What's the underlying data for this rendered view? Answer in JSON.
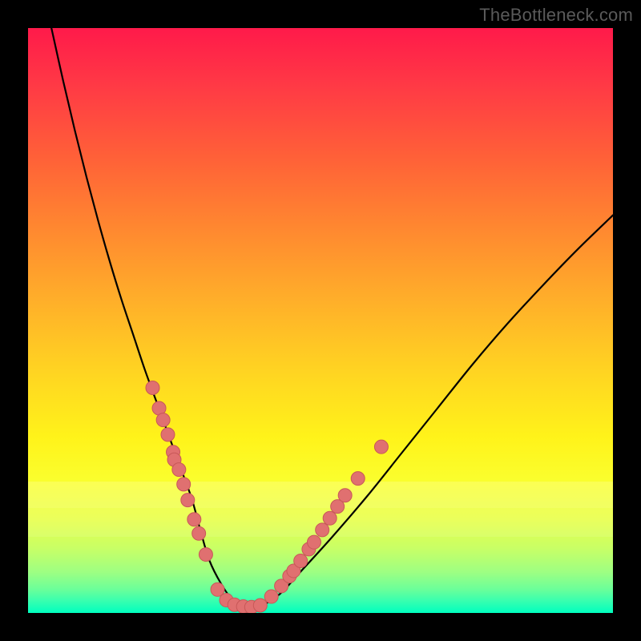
{
  "watermark": "TheBottleneck.com",
  "colors": {
    "frame": "#000000",
    "curve_stroke": "#000000",
    "ring_fill": "#e07070",
    "ring_stroke": "#c85858"
  },
  "chart_data": {
    "type": "line",
    "title": "",
    "xlabel": "",
    "ylabel": "",
    "xlim": [
      0,
      100
    ],
    "ylim": [
      0,
      100
    ],
    "grid": false,
    "series": [
      {
        "name": "bottleneck-curve",
        "x": [
          4,
          6,
          8,
          10,
          12,
          14,
          16,
          18,
          20,
          22,
          24,
          26,
          28,
          29.5,
          31,
          33,
          35,
          37,
          39.5,
          43,
          47,
          52,
          58,
          64,
          70,
          76,
          82,
          88,
          94,
          100
        ],
        "y": [
          100,
          91,
          82.5,
          74.5,
          67,
          60,
          53.5,
          47.5,
          41.5,
          36,
          30.5,
          25,
          19.5,
          14,
          9,
          5,
          2.2,
          1,
          1.1,
          3.2,
          7.5,
          13,
          20,
          27.5,
          35,
          42.5,
          49.5,
          56,
          62.2,
          68
        ]
      }
    ],
    "marker_clusters": [
      {
        "name": "left-descent-markers",
        "points": [
          {
            "x": 21.3,
            "y": 38.5
          },
          {
            "x": 22.4,
            "y": 35.0
          },
          {
            "x": 23.1,
            "y": 33.0
          },
          {
            "x": 23.9,
            "y": 30.5
          },
          {
            "x": 24.8,
            "y": 27.5
          },
          {
            "x": 25.0,
            "y": 26.2
          },
          {
            "x": 25.8,
            "y": 24.5
          },
          {
            "x": 26.6,
            "y": 22.0
          },
          {
            "x": 27.3,
            "y": 19.3
          },
          {
            "x": 28.4,
            "y": 16.0
          },
          {
            "x": 29.2,
            "y": 13.6
          },
          {
            "x": 30.4,
            "y": 10.0
          }
        ]
      },
      {
        "name": "valley-markers",
        "points": [
          {
            "x": 32.4,
            "y": 4.0
          },
          {
            "x": 33.9,
            "y": 2.2
          },
          {
            "x": 35.3,
            "y": 1.4
          },
          {
            "x": 36.8,
            "y": 1.1
          },
          {
            "x": 38.2,
            "y": 1.0
          },
          {
            "x": 39.7,
            "y": 1.3
          }
        ]
      },
      {
        "name": "right-ascent-markers",
        "points": [
          {
            "x": 41.6,
            "y": 2.8
          },
          {
            "x": 43.3,
            "y": 4.6
          },
          {
            "x": 44.7,
            "y": 6.3
          },
          {
            "x": 45.4,
            "y": 7.2
          },
          {
            "x": 46.6,
            "y": 8.9
          },
          {
            "x": 48.0,
            "y": 10.9
          },
          {
            "x": 48.9,
            "y": 12.1
          },
          {
            "x": 50.3,
            "y": 14.2
          },
          {
            "x": 51.6,
            "y": 16.2
          },
          {
            "x": 52.9,
            "y": 18.2
          },
          {
            "x": 54.2,
            "y": 20.1
          },
          {
            "x": 56.4,
            "y": 23.0
          },
          {
            "x": 60.4,
            "y": 28.4
          }
        ]
      }
    ]
  }
}
